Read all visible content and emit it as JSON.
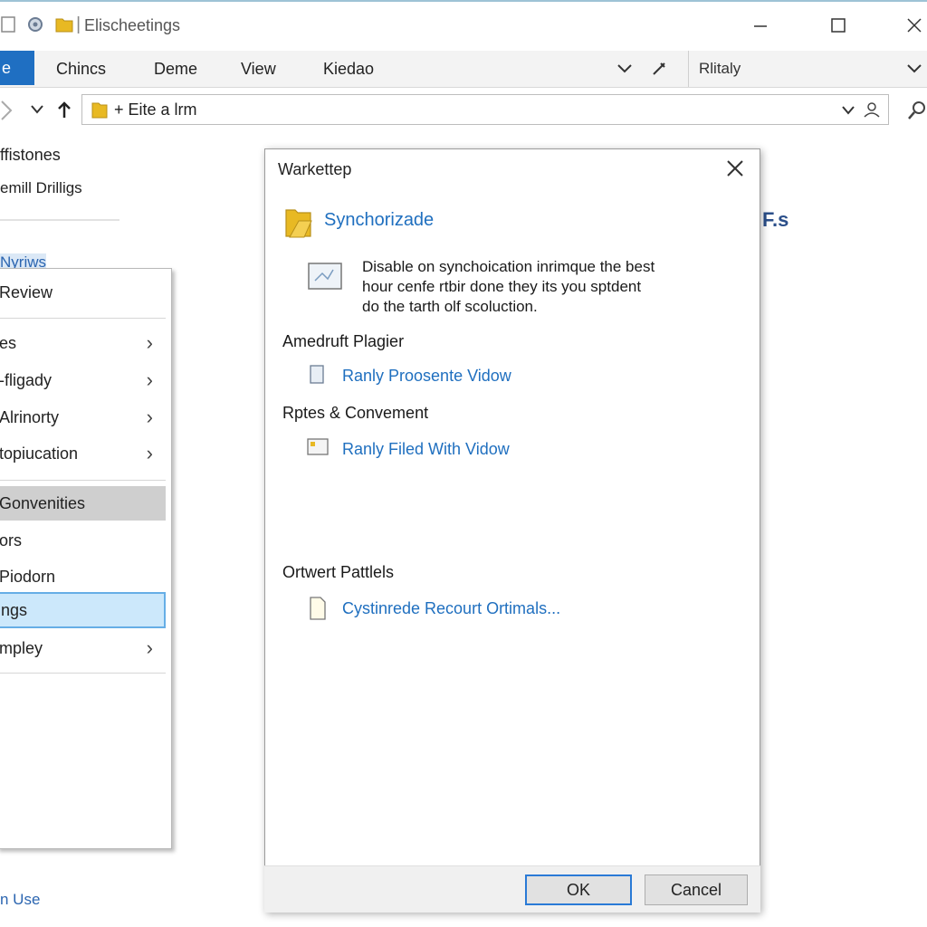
{
  "window": {
    "title": "Elischeetings"
  },
  "ribbon": {
    "file_label": "e",
    "tabs": [
      "Chincs",
      "Deme",
      "View",
      "Kiedao"
    ],
    "right_label": "Rlitaly"
  },
  "address": {
    "path": "+ Eite a lrm"
  },
  "left_pane": {
    "item1": "ffistones",
    "item2": "emill Drilligs",
    "section": "Nyriws",
    "footer": "n Use"
  },
  "context_menu": {
    "header": "Review",
    "items": [
      {
        "label": "es",
        "submenu": true
      },
      {
        "label": "-fligady",
        "submenu": true
      },
      {
        "label": "Alrinorty",
        "submenu": true
      },
      {
        "label": "topiucation",
        "submenu": true
      },
      {
        "label": "Gonvenities",
        "submenu": false
      },
      {
        "label": "ors",
        "submenu": false
      },
      {
        "label": "Piodorn",
        "submenu": false
      },
      {
        "label": "ngs",
        "submenu": false
      },
      {
        "label": "mpley",
        "submenu": true
      }
    ]
  },
  "background_fragment": "F.s",
  "dialog": {
    "title": "Warkettep",
    "heading": "Synchorizade",
    "description_lines": [
      "Disable on synchoication inrimque the best",
      "hour cenfe rtbir done they its you sptdent",
      "do the tarth olf scoluction."
    ],
    "sections": [
      {
        "header": "Amedruft Plagier",
        "link": "Ranly Proosente Vidow"
      },
      {
        "header": "Rptes & Convement",
        "link": "Ranly Filed With Vidow"
      },
      {
        "header": "Ortwert Pattlels",
        "link": "Cystinrede Recourt Ortimals..."
      }
    ],
    "ok_label": "OK",
    "cancel_label": "Cancel"
  },
  "colors": {
    "accent": "#1f6fc2",
    "link": "#1f6fbf",
    "selection_fill": "#cce8fb",
    "selection_border": "#66aee6",
    "folder": "#e8b923"
  },
  "icons": [
    "folder-icon",
    "gear-icon",
    "minimize-icon",
    "maximize-icon",
    "close-icon",
    "back-icon",
    "up-arrow-icon",
    "search-icon",
    "pin-icon",
    "document-icon"
  ]
}
